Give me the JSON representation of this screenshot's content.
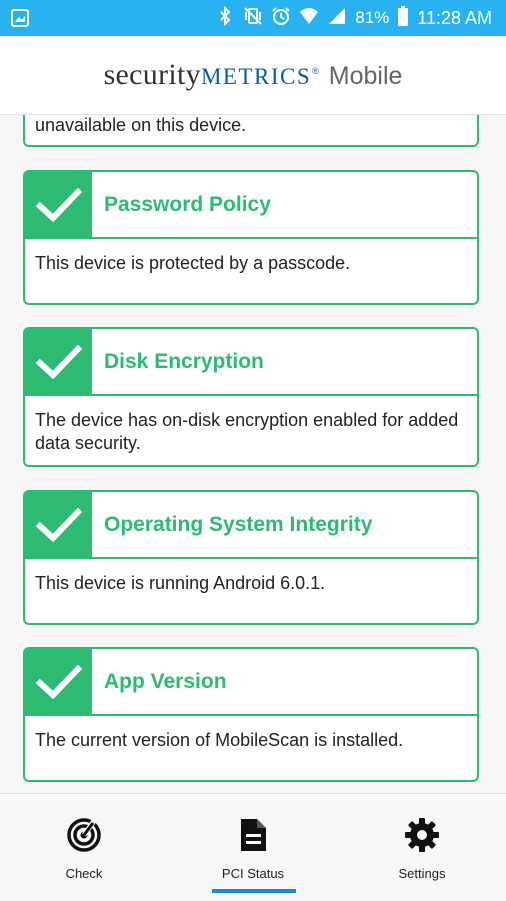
{
  "status_bar": {
    "battery": "81%",
    "time": "11:28 AM",
    "icons": [
      "image-icon",
      "bluetooth-icon",
      "vibrate-icon",
      "alarm-icon",
      "wifi-icon",
      "signal-icon",
      "battery-icon"
    ]
  },
  "header": {
    "logo_security": "security",
    "logo_metrics": "METRICS",
    "logo_reg": "®",
    "logo_mobile": "Mobile"
  },
  "cards": [
    {
      "title": "",
      "text": "unavailable on this device."
    },
    {
      "title": "Password Policy",
      "text": "This device is protected by a passcode."
    },
    {
      "title": "Disk Encryption",
      "text": "The device has on-disk encryption enabled for added data security."
    },
    {
      "title": "Operating System Integrity",
      "text": "This device is running Android 6.0.1."
    },
    {
      "title": "App Version",
      "text": "The current version of MobileScan is installed."
    }
  ],
  "bottom_nav": {
    "items": [
      {
        "label": "Check",
        "icon": "radar-icon"
      },
      {
        "label": "PCI Status",
        "icon": "document-icon",
        "active": true
      },
      {
        "label": "Settings",
        "icon": "gear-icon"
      }
    ]
  },
  "colors": {
    "status_bar": "#29b2f0",
    "accent_green": "#2dbb74",
    "logo_blue": "#0a5aa5",
    "active_indicator": "#1e88d2"
  }
}
